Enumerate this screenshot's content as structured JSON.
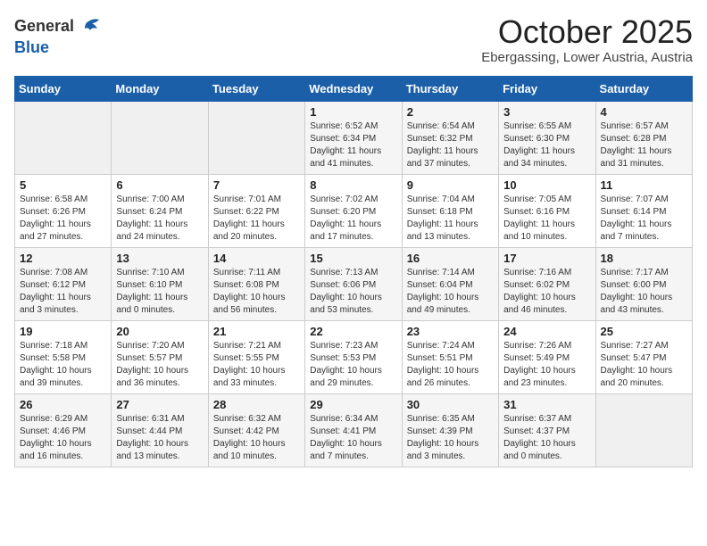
{
  "header": {
    "logo_line1": "General",
    "logo_line2": "Blue",
    "month": "October 2025",
    "location": "Ebergassing, Lower Austria, Austria"
  },
  "weekdays": [
    "Sunday",
    "Monday",
    "Tuesday",
    "Wednesday",
    "Thursday",
    "Friday",
    "Saturday"
  ],
  "weeks": [
    [
      {
        "day": "",
        "info": ""
      },
      {
        "day": "",
        "info": ""
      },
      {
        "day": "",
        "info": ""
      },
      {
        "day": "1",
        "info": "Sunrise: 6:52 AM\nSunset: 6:34 PM\nDaylight: 11 hours\nand 41 minutes."
      },
      {
        "day": "2",
        "info": "Sunrise: 6:54 AM\nSunset: 6:32 PM\nDaylight: 11 hours\nand 37 minutes."
      },
      {
        "day": "3",
        "info": "Sunrise: 6:55 AM\nSunset: 6:30 PM\nDaylight: 11 hours\nand 34 minutes."
      },
      {
        "day": "4",
        "info": "Sunrise: 6:57 AM\nSunset: 6:28 PM\nDaylight: 11 hours\nand 31 minutes."
      }
    ],
    [
      {
        "day": "5",
        "info": "Sunrise: 6:58 AM\nSunset: 6:26 PM\nDaylight: 11 hours\nand 27 minutes."
      },
      {
        "day": "6",
        "info": "Sunrise: 7:00 AM\nSunset: 6:24 PM\nDaylight: 11 hours\nand 24 minutes."
      },
      {
        "day": "7",
        "info": "Sunrise: 7:01 AM\nSunset: 6:22 PM\nDaylight: 11 hours\nand 20 minutes."
      },
      {
        "day": "8",
        "info": "Sunrise: 7:02 AM\nSunset: 6:20 PM\nDaylight: 11 hours\nand 17 minutes."
      },
      {
        "day": "9",
        "info": "Sunrise: 7:04 AM\nSunset: 6:18 PM\nDaylight: 11 hours\nand 13 minutes."
      },
      {
        "day": "10",
        "info": "Sunrise: 7:05 AM\nSunset: 6:16 PM\nDaylight: 11 hours\nand 10 minutes."
      },
      {
        "day": "11",
        "info": "Sunrise: 7:07 AM\nSunset: 6:14 PM\nDaylight: 11 hours\nand 7 minutes."
      }
    ],
    [
      {
        "day": "12",
        "info": "Sunrise: 7:08 AM\nSunset: 6:12 PM\nDaylight: 11 hours\nand 3 minutes."
      },
      {
        "day": "13",
        "info": "Sunrise: 7:10 AM\nSunset: 6:10 PM\nDaylight: 11 hours\nand 0 minutes."
      },
      {
        "day": "14",
        "info": "Sunrise: 7:11 AM\nSunset: 6:08 PM\nDaylight: 10 hours\nand 56 minutes."
      },
      {
        "day": "15",
        "info": "Sunrise: 7:13 AM\nSunset: 6:06 PM\nDaylight: 10 hours\nand 53 minutes."
      },
      {
        "day": "16",
        "info": "Sunrise: 7:14 AM\nSunset: 6:04 PM\nDaylight: 10 hours\nand 49 minutes."
      },
      {
        "day": "17",
        "info": "Sunrise: 7:16 AM\nSunset: 6:02 PM\nDaylight: 10 hours\nand 46 minutes."
      },
      {
        "day": "18",
        "info": "Sunrise: 7:17 AM\nSunset: 6:00 PM\nDaylight: 10 hours\nand 43 minutes."
      }
    ],
    [
      {
        "day": "19",
        "info": "Sunrise: 7:18 AM\nSunset: 5:58 PM\nDaylight: 10 hours\nand 39 minutes."
      },
      {
        "day": "20",
        "info": "Sunrise: 7:20 AM\nSunset: 5:57 PM\nDaylight: 10 hours\nand 36 minutes."
      },
      {
        "day": "21",
        "info": "Sunrise: 7:21 AM\nSunset: 5:55 PM\nDaylight: 10 hours\nand 33 minutes."
      },
      {
        "day": "22",
        "info": "Sunrise: 7:23 AM\nSunset: 5:53 PM\nDaylight: 10 hours\nand 29 minutes."
      },
      {
        "day": "23",
        "info": "Sunrise: 7:24 AM\nSunset: 5:51 PM\nDaylight: 10 hours\nand 26 minutes."
      },
      {
        "day": "24",
        "info": "Sunrise: 7:26 AM\nSunset: 5:49 PM\nDaylight: 10 hours\nand 23 minutes."
      },
      {
        "day": "25",
        "info": "Sunrise: 7:27 AM\nSunset: 5:47 PM\nDaylight: 10 hours\nand 20 minutes."
      }
    ],
    [
      {
        "day": "26",
        "info": "Sunrise: 6:29 AM\nSunset: 4:46 PM\nDaylight: 10 hours\nand 16 minutes."
      },
      {
        "day": "27",
        "info": "Sunrise: 6:31 AM\nSunset: 4:44 PM\nDaylight: 10 hours\nand 13 minutes."
      },
      {
        "day": "28",
        "info": "Sunrise: 6:32 AM\nSunset: 4:42 PM\nDaylight: 10 hours\nand 10 minutes."
      },
      {
        "day": "29",
        "info": "Sunrise: 6:34 AM\nSunset: 4:41 PM\nDaylight: 10 hours\nand 7 minutes."
      },
      {
        "day": "30",
        "info": "Sunrise: 6:35 AM\nSunset: 4:39 PM\nDaylight: 10 hours\nand 3 minutes."
      },
      {
        "day": "31",
        "info": "Sunrise: 6:37 AM\nSunset: 4:37 PM\nDaylight: 10 hours\nand 0 minutes."
      },
      {
        "day": "",
        "info": ""
      }
    ]
  ]
}
